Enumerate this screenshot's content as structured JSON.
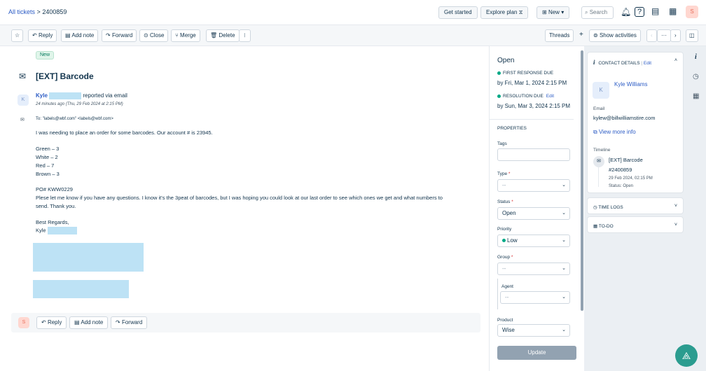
{
  "topbar": {
    "crumb_link": "All tickets",
    "crumb_sep": ">",
    "ticket_id": "2400859",
    "get_started": "Get started",
    "explore_plan": "Explore plan",
    "explore_icon": "⧖",
    "new_btn": "New",
    "search_placeholder": "Search",
    "avatar_letter": "S"
  },
  "actions": {
    "star": "☆",
    "reply": "Reply",
    "add_note": "Add note",
    "forward": "Forward",
    "close": "Close",
    "merge": "Merge",
    "delete": "Delete",
    "more": "⁝",
    "threads": "Threads",
    "plus": "+",
    "show_activities": "Show activities",
    "prev": "‹",
    "dots": "···",
    "next": "›"
  },
  "ticket": {
    "badge": "New",
    "subject": "[EXT] Barcode",
    "avatar_letter": "K",
    "sender_name": "Kyle",
    "reported_via": "reported via email",
    "time_ago": "24 minutes ago (Thu, 29 Feb 2024 at 2:15 PM)",
    "to_label": "To:",
    "to_value": "\"labels@wbf.com\" <labels@wbf.com>",
    "body": [
      "I was needing to place an order for some barcodes. Our account # is 23945.",
      "Green – 3",
      "White – 2",
      "Red – 7",
      "Brown – 3",
      "PO# KWW0229",
      "Plese let me know if you have any questions. I know it's the 3peat of barcodes, but I was hoping you could look at our last order to see which ones we get and what numbers to",
      "send. Thank you.",
      "Best Regards,",
      "Kyle"
    ]
  },
  "replybar": {
    "avatar_letter": "S",
    "reply": "Reply",
    "add_note": "Add note",
    "forward": "Forward"
  },
  "properties": {
    "status_title": "Open",
    "first_response_label": "FIRST RESPONSE DUE",
    "first_response_value": "by Fri, Mar 1, 2024 2:15 PM",
    "resolution_label": "RESOLUTION DUE",
    "resolution_edit": "Edit",
    "resolution_value": "by Sun, Mar 3, 2024 2:15 PM",
    "heading": "PROPERTIES",
    "tags_label": "Tags",
    "type_label": "Type",
    "type_value": "--",
    "status_label": "Status",
    "status_value": "Open",
    "priority_label": "Priority",
    "priority_value": "Low",
    "group_label": "Group",
    "group_value": "--",
    "agent_label": "Agent",
    "agent_value": "--",
    "product_label": "Product",
    "product_value": "Wise",
    "update": "Update"
  },
  "contact": {
    "header": "CONTACT DETAILS",
    "header_sep": "|",
    "edit": "Edit",
    "avatar_letter": "K",
    "name": "Kyle Williams",
    "email_label": "Email",
    "email": "kylew@billwilliamstire.com",
    "view_more": "View more info",
    "timeline_label": "Timeline",
    "tl_subject": "[EXT] Barcode",
    "tl_id": "#2400859",
    "tl_date": "29 Feb 2024, 02:15 PM",
    "tl_status": "Status: Open"
  },
  "accordions": {
    "time_logs": "TIME LOGS",
    "todo": "TO-DO"
  },
  "colors": {
    "accent": "#2c5cc5",
    "redaction": "#bde2f5",
    "fab": "#2b9c8f",
    "success": "#00a886"
  }
}
